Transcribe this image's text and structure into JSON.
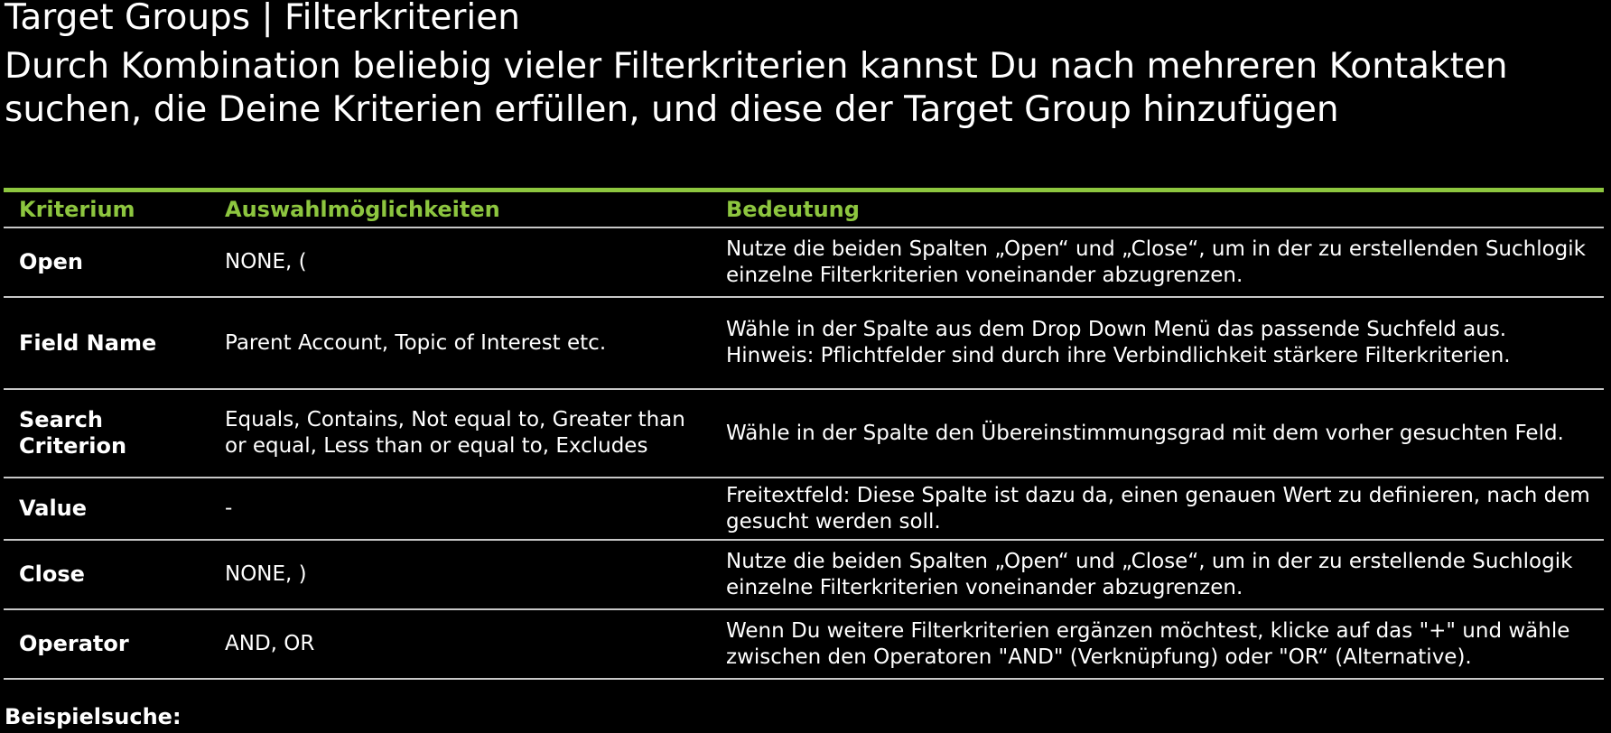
{
  "header": {
    "title": "Target Groups | Filterkriterien",
    "subtitle": "Durch Kombination beliebig vieler Filterkriterien kannst Du nach mehreren Kontakten suchen, die Deine Kriterien erfüllen, und diese der Target Group hinzufügen"
  },
  "table": {
    "columns": [
      "Kriterium",
      "Auswahlmöglichkeiten",
      "Bedeutung"
    ],
    "rows": [
      {
        "criterion": "Open",
        "options": "NONE, (",
        "meaning": "Nutze die beiden Spalten „Open“ und „Close“, um in der zu erstellenden Suchlogik einzelne Filterkriterien voneinander abzugrenzen."
      },
      {
        "criterion": "Field Name",
        "options": "Parent Account, Topic of Interest etc.",
        "meaning": "Wähle in der Spalte aus dem Drop Down Menü das passende Suchfeld aus. Hinweis: Pflichtfelder sind durch ihre Verbindlichkeit stärkere Filterkriterien."
      },
      {
        "criterion": "Search Criterion",
        "options": "Equals, Contains, Not equal to, Greater than or equal, Less than or equal to, Excludes",
        "meaning": "Wähle in der Spalte den Übereinstimmungsgrad mit dem vorher gesuchten Feld."
      },
      {
        "criterion": "Value",
        "options": "-",
        "meaning": "Freitextfeld: Diese Spalte ist dazu da, einen genauen Wert zu definieren, nach dem gesucht werden soll."
      },
      {
        "criterion": "Close",
        "options": "NONE, )",
        "meaning": "Nutze die beiden Spalten „Open“ und „Close“, um in der zu erstellende Suchlogik einzelne Filterkriterien voneinander abzugrenzen."
      },
      {
        "criterion": "Operator",
        "options": "AND, OR",
        "meaning": "Wenn Du weitere Filterkriterien ergänzen möchtest, klicke auf das \"+\" und wähle zwischen den Operatoren \"AND\" (Verknüpfung) oder \"OR“ (Alternative)."
      }
    ]
  },
  "footer": {
    "label": "Beispielsuche:"
  },
  "colors": {
    "accent": "#8dc63f",
    "background": "#000000",
    "text": "#ffffff",
    "divider": "#c8c8c8"
  }
}
